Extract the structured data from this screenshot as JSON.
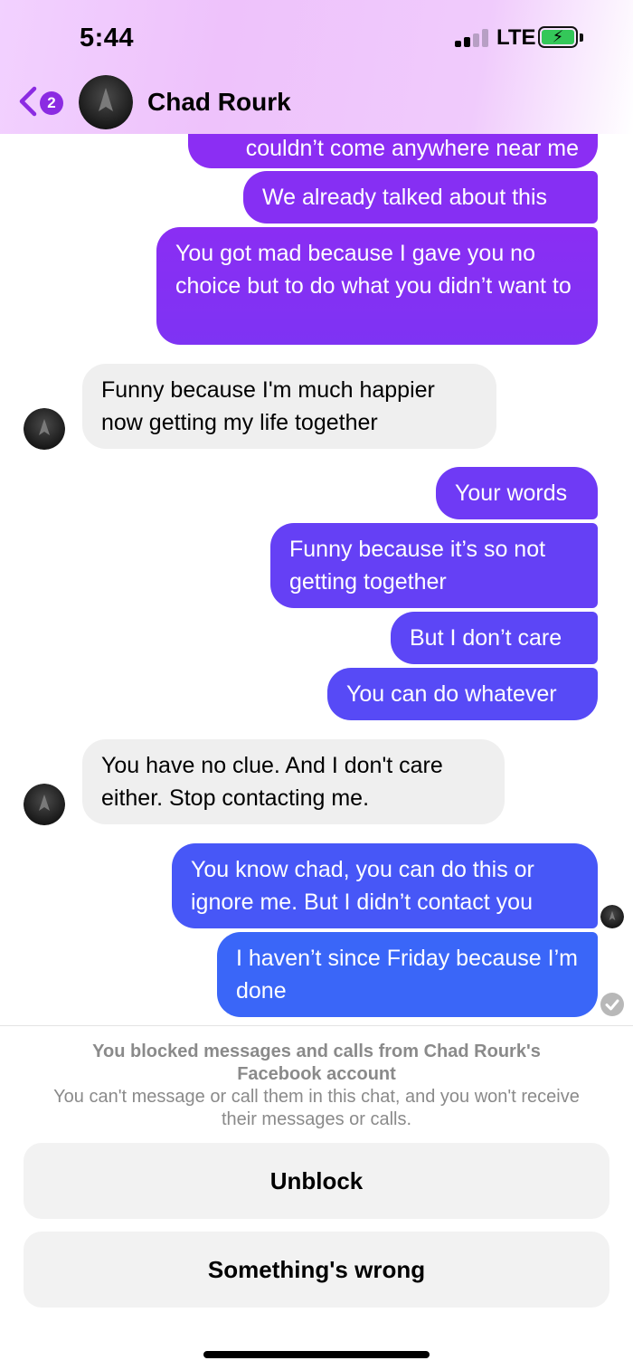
{
  "status_bar": {
    "time": "5:44",
    "network": "LTE"
  },
  "header": {
    "unread_count": "2",
    "contact_name": "Chad Rourk"
  },
  "messages": [
    {
      "text": "couldn’t come anywhere near me",
      "from": "me"
    },
    {
      "text": "We already talked about this",
      "from": "me"
    },
    {
      "text": "You got mad because I gave you no choice but to do what you didn’t want to",
      "from": "me"
    },
    {
      "text": "Funny because I'm much happier now getting my life together",
      "from": "them"
    },
    {
      "text": "Your words",
      "from": "me"
    },
    {
      "text": "Funny because it’s so not getting together",
      "from": "me"
    },
    {
      "text": "But I don’t care",
      "from": "me"
    },
    {
      "text": "You can do whatever",
      "from": "me"
    },
    {
      "text": "You have no clue. And I don't care either. Stop contacting me.",
      "from": "them"
    },
    {
      "text": "You know chad, you can do this or ignore me. But I didn’t contact you",
      "from": "me"
    },
    {
      "text": "I haven’t since Friday because I’m done",
      "from": "me"
    }
  ],
  "blocked_notice": {
    "title": "You blocked messages and calls from Chad Rourk's Facebook account",
    "description": "You can't message or call them in this chat, and you won't receive their messages or calls."
  },
  "actions": {
    "unblock": "Unblock",
    "something_wrong": "Something's wrong"
  },
  "colors": {
    "accent": "#8b2be2",
    "bubble_purple": "#8a2ef2",
    "bubble_indigo": "#5a4ff6",
    "bubble_blue": "#3a66f7",
    "incoming": "#efefef"
  }
}
